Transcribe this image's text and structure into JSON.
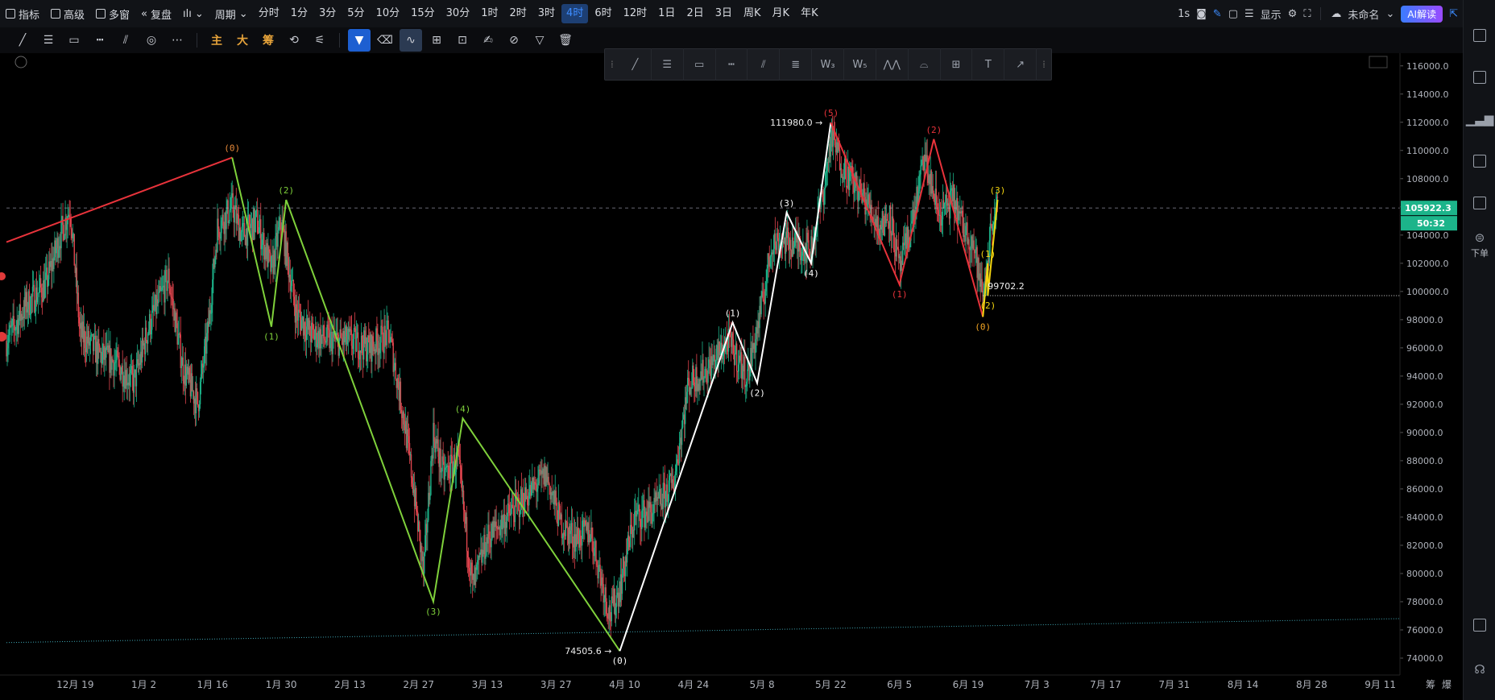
{
  "toolbar": {
    "indicators": "指标",
    "advanced": "高级",
    "multi_window": "多窗",
    "replay": "复盘",
    "period_label": "周期",
    "periods": [
      "分时",
      "1分",
      "3分",
      "5分",
      "10分",
      "15分",
      "30分",
      "1时",
      "2时",
      "3时",
      "4时",
      "6时",
      "12时",
      "1日",
      "2日",
      "3日",
      "周K",
      "月K",
      "年K"
    ],
    "active_period": "4时",
    "refresh_interval": "1s",
    "display_label": "显示",
    "cloud_name": "未命名",
    "ai_label": "AI解读"
  },
  "drawing_tools": {
    "labels": [
      "主",
      "大",
      "筹"
    ]
  },
  "chart_data": {
    "type": "candlestick",
    "symbol_price": {
      "last_price": "105922.3",
      "countdown": "50:32",
      "annotations": [
        {
          "text": "111980.0",
          "x": "2025-05-22",
          "y": 111980.0
        },
        {
          "text": "74505.6",
          "x": "2025-04-09",
          "y": 74505.6
        },
        {
          "text": "99702.2",
          "x": "2025-06-22",
          "y": 99702.2
        }
      ]
    },
    "yaxis": {
      "ticks": [
        116000,
        114000,
        112000,
        110000,
        108000,
        106000,
        104000,
        102000,
        100000,
        98000,
        96000,
        94000,
        92000,
        90000,
        88000,
        86000,
        84000,
        82000,
        80000,
        78000,
        76000,
        74000
      ],
      "tick_labels": [
        "116000.0",
        "114000.0",
        "112000.0",
        "110000.0",
        "108000.0",
        "106000.0",
        "104000.0",
        "102000.0",
        "100000.0",
        "98000.0",
        "96000.0",
        "94000.0",
        "92000.0",
        "90000.0",
        "88000.0",
        "86000.0",
        "84000.0",
        "82000.0",
        "80000.0",
        "78000.0",
        "76000.0",
        "74000.0"
      ],
      "ylim": [
        72800,
        116900
      ]
    },
    "xaxis": {
      "tick_labels": [
        "12月 19",
        "1月 2",
        "1月 16",
        "1月 30",
        "2月 13",
        "2月 27",
        "3月 13",
        "3月 27",
        "4月 10",
        "4月 24",
        "5月 8",
        "5月 22",
        "6月 5",
        "6月 19",
        "7月 3",
        "7月 17",
        "7月 31",
        "8月 14",
        "8月 28",
        "9月 11"
      ],
      "tick_dates": [
        "2024-12-19",
        "2025-01-02",
        "2025-01-16",
        "2025-01-30",
        "2025-02-13",
        "2025-02-27",
        "2025-03-13",
        "2025-03-27",
        "2025-04-10",
        "2025-04-24",
        "2025-05-08",
        "2025-05-22",
        "2025-06-05",
        "2025-06-19",
        "2025-07-03",
        "2025-07-17",
        "2025-07-31",
        "2025-08-14",
        "2025-08-28",
        "2025-09-11"
      ],
      "xlim": [
        "2024-12-05",
        "2025-09-15"
      ],
      "corner_labels": [
        "筹",
        "爆"
      ]
    },
    "price_path": [
      [
        "2024-12-05",
        96500
      ],
      [
        "2024-12-09",
        99000
      ],
      [
        "2024-12-13",
        100500
      ],
      [
        "2024-12-16",
        104000
      ],
      [
        "2024-12-18",
        106000
      ],
      [
        "2024-12-20",
        97000
      ],
      [
        "2024-12-24",
        95500
      ],
      [
        "2024-12-27",
        95000
      ],
      [
        "2024-12-31",
        93500
      ],
      [
        "2025-01-03",
        97500
      ],
      [
        "2025-01-07",
        101000
      ],
      [
        "2025-01-10",
        94500
      ],
      [
        "2025-01-13",
        92000
      ],
      [
        "2025-01-15",
        97000
      ],
      [
        "2025-01-17",
        104500
      ],
      [
        "2025-01-20",
        106000
      ],
      [
        "2025-01-22",
        104000
      ],
      [
        "2025-01-25",
        105000
      ],
      [
        "2025-01-28",
        101500
      ],
      [
        "2025-01-30",
        105000
      ],
      [
        "2025-02-02",
        98500
      ],
      [
        "2025-02-05",
        97000
      ],
      [
        "2025-02-09",
        96500
      ],
      [
        "2025-02-13",
        96500
      ],
      [
        "2025-02-17",
        96000
      ],
      [
        "2025-02-21",
        97000
      ],
      [
        "2025-02-24",
        91000
      ],
      [
        "2025-02-26",
        86000
      ],
      [
        "2025-02-28",
        80000
      ],
      [
        "2025-03-02",
        90000
      ],
      [
        "2025-03-04",
        87000
      ],
      [
        "2025-03-07",
        88000
      ],
      [
        "2025-03-10",
        79000
      ],
      [
        "2025-03-13",
        82500
      ],
      [
        "2025-03-17",
        84000
      ],
      [
        "2025-03-21",
        85500
      ],
      [
        "2025-03-25",
        87000
      ],
      [
        "2025-03-28",
        83500
      ],
      [
        "2025-03-31",
        82500
      ],
      [
        "2025-04-03",
        83000
      ],
      [
        "2025-04-07",
        77000
      ],
      [
        "2025-04-09",
        79000
      ],
      [
        "2025-04-12",
        84000
      ],
      [
        "2025-04-16",
        84500
      ],
      [
        "2025-04-20",
        86500
      ],
      [
        "2025-04-23",
        93500
      ],
      [
        "2025-04-27",
        94500
      ],
      [
        "2025-05-01",
        96500
      ],
      [
        "2025-05-05",
        94000
      ],
      [
        "2025-05-08",
        99000
      ],
      [
        "2025-05-10",
        103500
      ],
      [
        "2025-05-14",
        103500
      ],
      [
        "2025-05-18",
        103000
      ],
      [
        "2025-05-21",
        108000
      ],
      [
        "2025-05-22",
        111000
      ],
      [
        "2025-05-25",
        108500
      ],
      [
        "2025-05-29",
        106500
      ],
      [
        "2025-06-01",
        104500
      ],
      [
        "2025-06-03",
        105500
      ],
      [
        "2025-06-05",
        101500
      ],
      [
        "2025-06-08",
        105500
      ],
      [
        "2025-06-10",
        109500
      ],
      [
        "2025-06-13",
        105500
      ],
      [
        "2025-06-16",
        106500
      ],
      [
        "2025-06-18",
        104500
      ],
      [
        "2025-06-20",
        103500
      ],
      [
        "2025-06-22",
        99500
      ],
      [
        "2025-06-24",
        105500
      ],
      [
        "2025-06-25",
        105922
      ]
    ],
    "wave_series": [
      {
        "color": "#e8333b",
        "points": [
          [
            "2024-12-05",
            103500
          ],
          [
            "2025-01-20",
            109500
          ]
        ],
        "labels": [
          {
            "text": "(0)",
            "at": 1,
            "color": "#e88a3a"
          }
        ]
      },
      {
        "color": "#7fd13b",
        "points": [
          [
            "2025-01-20",
            109500
          ],
          [
            "2025-01-28",
            97500
          ],
          [
            "2025-01-31",
            106500
          ],
          [
            "2025-03-02",
            78000
          ],
          [
            "2025-03-08",
            91000
          ],
          [
            "2025-04-09",
            74505
          ]
        ],
        "labels": [
          {
            "text": "(1)",
            "at": 1
          },
          {
            "text": "(2)",
            "at": 2
          },
          {
            "text": "(3)",
            "at": 3
          },
          {
            "text": "(4)",
            "at": 4
          }
        ]
      },
      {
        "color": "#ffffff",
        "points": [
          [
            "2025-04-09",
            74505
          ],
          [
            "2025-05-02",
            97800
          ],
          [
            "2025-05-07",
            93500
          ],
          [
            "2025-05-13",
            105600
          ],
          [
            "2025-05-18",
            102000
          ],
          [
            "2025-05-22",
            111980
          ]
        ],
        "labels": [
          {
            "text": "(0)",
            "at": 0
          },
          {
            "text": "(1)",
            "at": 1
          },
          {
            "text": "(2)",
            "at": 2
          },
          {
            "text": "(3)",
            "at": 3
          },
          {
            "text": "(4)",
            "at": 4
          }
        ]
      },
      {
        "color": "#e8333b",
        "points": [
          [
            "2025-05-22",
            111980
          ],
          [
            "2025-06-05",
            100500
          ],
          [
            "2025-06-12",
            110800
          ],
          [
            "2025-06-22",
            98200
          ]
        ],
        "labels": [
          {
            "text": "(5)",
            "at": 0
          },
          {
            "text": "(1)",
            "at": 1
          },
          {
            "text": "(2)",
            "at": 2
          }
        ]
      },
      {
        "color": "#f5d60f",
        "points": [
          [
            "2025-06-22",
            98200
          ],
          [
            "2025-06-23",
            102000
          ],
          [
            "2025-06-23",
            99702
          ],
          [
            "2025-06-25",
            106500
          ]
        ],
        "labels": [
          {
            "text": "(0)",
            "at": 0,
            "color": "#f5a623"
          },
          {
            "text": "(1)",
            "at": 1
          },
          {
            "text": "(2)",
            "at": 2
          },
          {
            "text": "(3)",
            "at": 3
          }
        ]
      }
    ],
    "reference_lines": [
      {
        "kind": "dashed-horizontal",
        "value": 105922.3
      },
      {
        "kind": "dotted-horizontal",
        "value": 99702.2,
        "from": "2025-06-22"
      },
      {
        "kind": "dotted-trend",
        "from": [
          "2024-12-05",
          75100
        ],
        "to": [
          "2025-09-15",
          76800
        ]
      }
    ]
  },
  "sidebar": {
    "order_label": "下单"
  }
}
